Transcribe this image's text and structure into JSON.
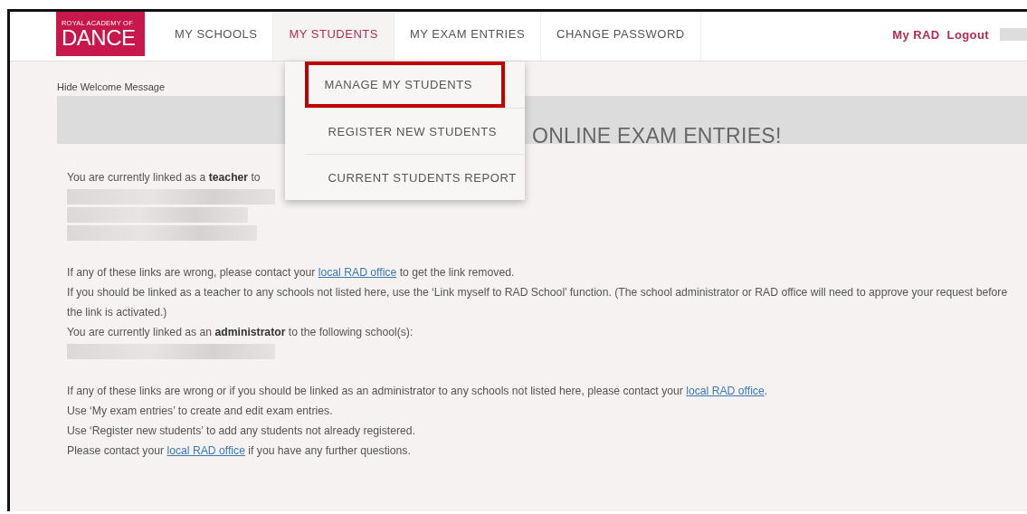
{
  "logo": {
    "line_1": "ROYAL ACADEMY OF",
    "line_2": "DANCE"
  },
  "nav": [
    {
      "label": "MY SCHOOLS",
      "selected": false
    },
    {
      "label": "MY STUDENTS",
      "selected": true
    },
    {
      "label": "MY EXAM ENTRIES",
      "selected": false
    },
    {
      "label": "CHANGE PASSWORD",
      "selected": false
    }
  ],
  "user_links": [
    "My RAD",
    "Logout"
  ],
  "dropdown": [
    {
      "label": "MANAGE MY STUDENTS",
      "highlighted": true
    },
    {
      "label": "REGISTER NEW STUDENTS",
      "highlighted": false
    },
    {
      "label": "CURRENT STUDENTS REPORT",
      "highlighted": false
    }
  ],
  "hide_welcome": "Hide Welcome Message",
  "banner_title": "ONLINE EXAM ENTRIES!",
  "paragraphs": [
    {
      "kind": "text",
      "text": "You are currently linked as a **teacher** to"
    },
    {
      "kind": "blurred"
    },
    {
      "kind": "gap"
    },
    {
      "kind": "link_text",
      "before": "If any of these links are wrong, please contact your ",
      "link": "local RAD office",
      "after": " to get the link removed."
    },
    {
      "kind": "text",
      "text": "If you should be linked as a teacher to any schools not listed here, use the ‘Link myself to RAD School’ function. (The school administrator or RAD office will need to approve your request before the link is activated.)"
    },
    {
      "kind": "text",
      "text": "You are currently linked as an **administrator** to the following school(s):"
    },
    {
      "kind": "redacted"
    },
    {
      "kind": "gap"
    },
    {
      "kind": "link_text",
      "before": "If any of these links are wrong or if you should be linked as an administrator to any schools not listed here, please contact your ",
      "link": "local RAD office",
      "after": "."
    },
    {
      "kind": "text",
      "text": "Use ‘My exam entries’ to create and edit exam entries."
    },
    {
      "kind": "text",
      "text": "Use ‘Register new students’ to add any students not already registered."
    },
    {
      "kind": "link_text",
      "before": "Please contact your ",
      "link": "local RAD office",
      "after": " if you have any further questions."
    }
  ]
}
